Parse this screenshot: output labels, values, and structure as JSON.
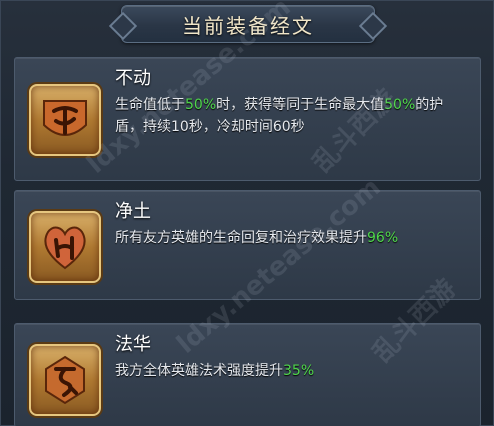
{
  "header": {
    "title": "当前装备经文"
  },
  "scriptures": [
    {
      "name": "不动",
      "desc_parts": [
        "生命值低于",
        "50%",
        "时，获得等同于生命最大值",
        "50%",
        "的护盾，持续10秒，冷却时间60秒"
      ],
      "icon": "budong-rune-icon"
    },
    {
      "name": "净土",
      "desc_parts": [
        "所有友方英雄的生命回复和治疗效果提升",
        "96%"
      ],
      "icon": "jingtu-rune-icon"
    },
    {
      "name": "法华",
      "desc_parts": [
        "我方全体英雄法术强度提升",
        "35%"
      ],
      "icon": "fahua-rune-icon"
    }
  ],
  "watermarks": [
    "ldxy.netease.com",
    "乱斗西游",
    "ldxy.netease.com",
    "乱斗西游"
  ],
  "colors": {
    "highlight": "#4fd64a",
    "title": "#f1e6c8",
    "icon_gold": "#d9b069"
  }
}
